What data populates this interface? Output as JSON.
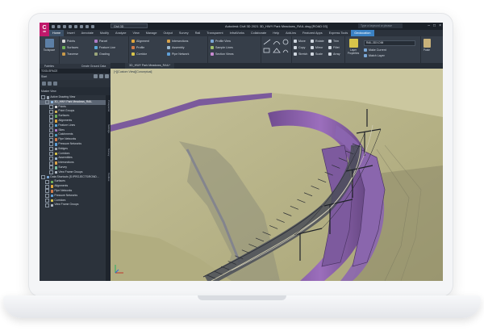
{
  "app": {
    "logo_letter": "C",
    "logo_sub": "3D",
    "workspace": "Civil 3D",
    "document_title": "Autodesk Civil 3D 2021   3D_HWY Park Meadows_RAIL.dwg [ROAD 03]",
    "search_placeholder": "Type a keyword or phrase",
    "window_controls": [
      "–",
      "□",
      "×"
    ]
  },
  "tabs": [
    "Home",
    "Insert",
    "Annotate",
    "Modify",
    "Analyze",
    "View",
    "Manage",
    "Output",
    "Survey",
    "Rail",
    "Transparent",
    "InfraWorks",
    "Collaborate",
    "Help",
    "Add-ins",
    "Featured Apps",
    "Express Tools",
    "Geolocation"
  ],
  "active_tab": "Home",
  "ribbon": {
    "toolspace_button": "Toolspace",
    "palettes_title": "Palettes",
    "ground_title": "Create Ground Data",
    "ground_items": [
      "Points",
      "Surfaces",
      "Traverse"
    ],
    "ground_items2": [
      "Parcel",
      "Feature Line",
      "Grading"
    ],
    "design_title": "Create Design",
    "design_items": [
      "Alignment",
      "Profile",
      "Corridor"
    ],
    "design_items2": [
      "Intersections",
      "Assembly",
      "Pipe Network"
    ],
    "profile_title": "Profile & Section Views",
    "profile_items": [
      "Profile View",
      "Sample Lines",
      "Section Views"
    ],
    "draw_title": "Draw",
    "modify_title": "Modify",
    "modify_items": [
      "Move",
      "Copy",
      "Stretch"
    ],
    "modify_items2": [
      "Rotate",
      "Mirror",
      "Scale"
    ],
    "modify_items3": [
      "Trim",
      "Fillet",
      "Array"
    ],
    "layers_title": "Layers",
    "layer_props": "Layer Properties",
    "layer_dropdown": "RAIL-3DX-DIM",
    "layer_actions": [
      "Make Current",
      "Match Layer"
    ],
    "clipboard_title": "Clipboard",
    "paste_label": "Paste"
  },
  "toolspace": {
    "title": "TOOLSPACE",
    "start_label": "Start",
    "view_label": "Master View",
    "tree": [
      {
        "label": "Active Drawing View",
        "level": 0,
        "color": "#9aa5b2"
      },
      {
        "label": "3D_HWY Park Meadows_RAIL",
        "level": 1,
        "color": "#8fb7e0",
        "selected": true
      },
      {
        "label": "Points",
        "level": 2,
        "color": "#d6d6d6"
      },
      {
        "label": "Point Groups",
        "level": 2,
        "color": "#d2b15a"
      },
      {
        "label": "Surfaces",
        "level": 2,
        "color": "#6fae5a"
      },
      {
        "label": "Alignments",
        "level": 2,
        "color": "#e0a63c"
      },
      {
        "label": "Feature Lines",
        "level": 2,
        "color": "#5aa7d8"
      },
      {
        "label": "Sites",
        "level": 2,
        "color": "#b07cc8"
      },
      {
        "label": "Catchments",
        "level": 2,
        "color": "#4fa0c0"
      },
      {
        "label": "Pipe Networks",
        "level": 2,
        "color": "#d07a4a"
      },
      {
        "label": "Pressure Networks",
        "level": 2,
        "color": "#5f9fd8"
      },
      {
        "label": "Bridges",
        "level": 2,
        "color": "#a0a8b2"
      },
      {
        "label": "Corridors",
        "level": 2,
        "color": "#d8c44a"
      },
      {
        "label": "Assemblies",
        "level": 2,
        "color": "#9ab7d0"
      },
      {
        "label": "Intersections",
        "level": 2,
        "color": "#d8a24a"
      },
      {
        "label": "Survey",
        "level": 2,
        "color": "#7ac0a0"
      },
      {
        "label": "View Frame Groups",
        "level": 2,
        "color": "#b0b8c2"
      },
      {
        "label": "Data Shortcuts [S:\\PROJECTS\\ROND...",
        "level": 0,
        "color": "#7aa7d6"
      },
      {
        "label": "Surfaces",
        "level": 1,
        "color": "#6fae5a"
      },
      {
        "label": "Alignments",
        "level": 1,
        "color": "#e0a63c"
      },
      {
        "label": "Pipe Networks",
        "level": 1,
        "color": "#d07a4a"
      },
      {
        "label": "Pressure Networks",
        "level": 1,
        "color": "#5f9fd8"
      },
      {
        "label": "Corridors",
        "level": 1,
        "color": "#d8c44a"
      },
      {
        "label": "View Frame Groups",
        "level": 1,
        "color": "#b0b8c2"
      }
    ],
    "side_tabs": [
      "Prospector",
      "Settings",
      "Survey",
      "Toolbox"
    ]
  },
  "viewport": {
    "label": "[+][Custom View][Conceptual]",
    "drawing_tab": "3D_HWY Park Meadows_RAIL*"
  },
  "colors": {
    "accent": "#3b82c4",
    "logo": "#c0196b",
    "terrain": "#bcb98a",
    "corridor": "#8a5aa8",
    "road": "#4a4e58"
  }
}
